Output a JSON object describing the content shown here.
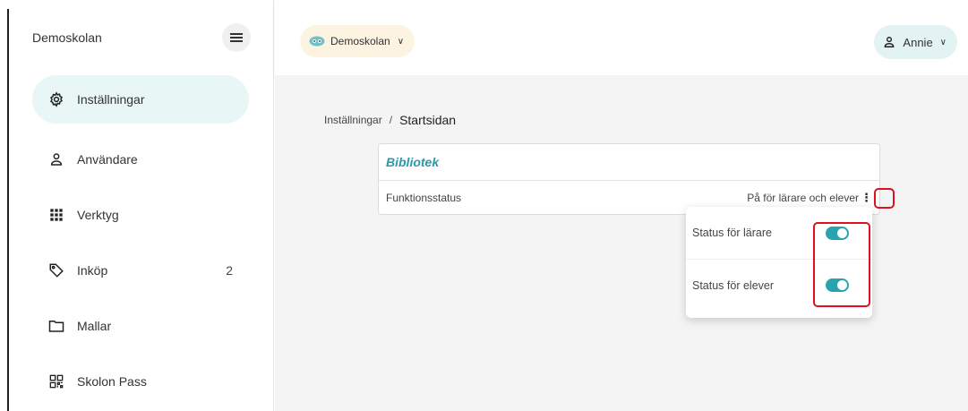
{
  "colors": {
    "accent": "#2a9aa6",
    "active_nav_bg": "#e9f6f6",
    "school_pill_bg": "#fdf3e1",
    "user_pill_bg": "#e3f2f3",
    "toggle_on": "#2aa3ae",
    "highlight": "#e0101e"
  },
  "sidebar": {
    "title": "Demoskolan",
    "menu_icon": "hamburger-icon",
    "items": [
      {
        "label": "Inställningar",
        "icon": "gear-icon",
        "active": true,
        "badge": ""
      },
      {
        "label": "Användare",
        "icon": "user-icon",
        "active": false,
        "badge": ""
      },
      {
        "label": "Verktyg",
        "icon": "grid-icon",
        "active": false,
        "badge": ""
      },
      {
        "label": "Inköp",
        "icon": "tag-icon",
        "active": false,
        "badge": "2"
      },
      {
        "label": "Mallar",
        "icon": "folder-icon",
        "active": false,
        "badge": ""
      },
      {
        "label": "Skolon Pass",
        "icon": "qr-icon",
        "active": false,
        "badge": ""
      }
    ]
  },
  "topbar": {
    "school": {
      "label": "Demoskolan",
      "icon": "school-logo-icon"
    },
    "user": {
      "label": "Annie",
      "icon": "user-icon"
    }
  },
  "breadcrumb": {
    "parent": "Inställningar",
    "separator": "/",
    "current": "Startsidan"
  },
  "card": {
    "title": "Bibliotek",
    "row_label": "Funktionsstatus",
    "row_value": "På för lärare och elever",
    "more_icon": "kebab-icon"
  },
  "menu": {
    "items": [
      {
        "label": "Status för lärare",
        "checked": true
      },
      {
        "label": "Status för elever",
        "checked": true
      }
    ]
  }
}
